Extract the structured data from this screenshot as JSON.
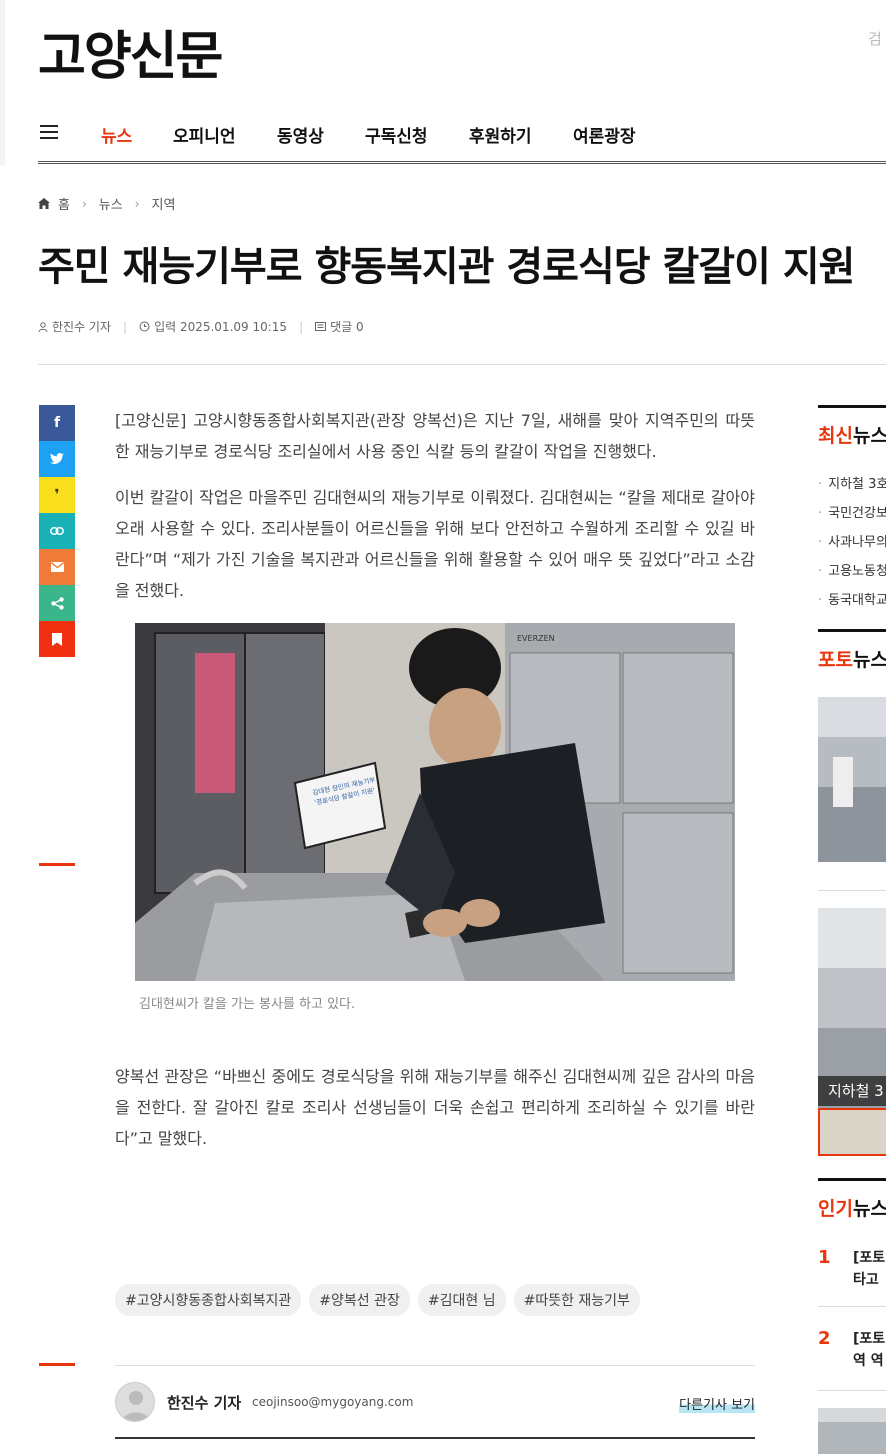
{
  "header": {
    "logo": "고양신문",
    "search_hint": "검"
  },
  "nav": {
    "items": [
      {
        "label": "뉴스",
        "active": true
      },
      {
        "label": "오피니언"
      },
      {
        "label": "동영상"
      },
      {
        "label": "구독신청"
      },
      {
        "label": "후원하기"
      },
      {
        "label": "여론광장"
      }
    ]
  },
  "breadcrumb": {
    "home": "홈",
    "section": "뉴스",
    "subsection": "지역"
  },
  "article": {
    "title": "주민 재능기부로 향동복지관 경로식당 칼갈이 지원",
    "author": "한진수 기자",
    "date": "입력 2025.01.09 10:15",
    "comments": "댓글 0",
    "paragraphs": [
      "[고양신문] 고양시향동종합사회복지관(관장 양복선)은 지난 7일, 새해를 맞아 지역주민의 따뜻한 재능기부로 경로식당 조리실에서 사용 중인 식칼 등의 칼갈이 작업을 진행했다.",
      "이번 칼갈이 작업은 마을주민 김대현씨의 재능기부로 이뤄졌다. 김대현씨는 “칼을 제대로 갈아야 오래 사용할 수 있다. 조리사분들이 어르신들을 위해 보다 안전하고 수월하게 조리할 수 있길 바란다”며 “제가 가진 기술을 복지관과 어르신들을 위해 활용할 수 있어 매우 뜻 깊었다”라고 소감을 전했다.",
      "양복선 관장은 “바쁘신 중에도 경로식당을 위해 재능기부를 해주신 김대현씨께 깊은 감사의 마음을 전한다. 잘 갈아진 칼로 조리사 선생님들이 더욱 손쉽고 편리하게 조리하실 수 있기를 바란다”고 말했다."
    ],
    "photo": {
      "caption": "김대현씨가 칼을 가는 봉사를 하고 있다.",
      "sign_line1": "김대현 장인의 재능기부",
      "sign_line2": "'경로식당 칼갈이 지원'",
      "fridge_brand": "EVERZEN"
    },
    "tags": [
      "#고양시향동종합사회복지관",
      "#양복선 관장",
      "#김대현 님",
      "#따뜻한 재능기부"
    ],
    "author_box": {
      "name": "한진수 기자",
      "email": "ceojinsoo@mygoyang.com",
      "more": "다른기사 보기"
    }
  },
  "share": [
    "facebook",
    "twitter",
    "kakaostory",
    "link",
    "email",
    "share",
    "bookmark"
  ],
  "sidebar": {
    "latest": {
      "accent": "최신",
      "rest": "뉴스",
      "items": [
        "지하철 3호",
        "국민건강보",
        "사과나무의",
        "고용노동청",
        "동국대학교"
      ]
    },
    "photo": {
      "accent": "포토",
      "rest": "뉴스",
      "overlay": "지하철 3"
    },
    "popular": {
      "accent": "인기",
      "rest": "뉴스",
      "items": [
        {
          "rank": "1",
          "line1": "[포토",
          "line2": "타고"
        },
        {
          "rank": "2",
          "line1": "[포토",
          "line2": "역 역"
        }
      ]
    }
  }
}
